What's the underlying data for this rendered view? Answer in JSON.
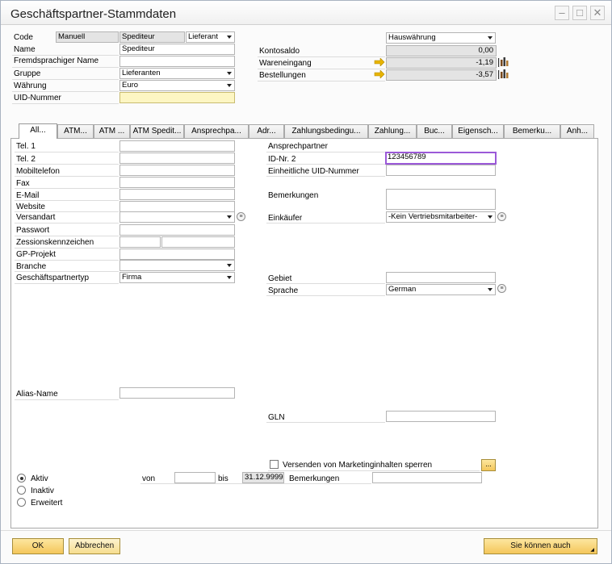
{
  "window": {
    "title": "Geschäftspartner-Stammdaten",
    "controls": [
      "–",
      "□",
      "✕"
    ]
  },
  "header": {
    "code_label": "Code",
    "code_series": "Manuell",
    "code_value": "Spediteur",
    "type_value": "Lieferant",
    "name_label": "Name",
    "name_value": "Spediteur",
    "foreign_name_label": "Fremdsprachiger Name",
    "foreign_name_value": "",
    "group_label": "Gruppe",
    "group_value": "Lieferanten",
    "currency_label": "Währung",
    "currency_value": "Euro",
    "uid_label": "UID-Nummer",
    "uid_value": "",
    "currency_select": "Hauswährung",
    "balance_label": "Kontosaldo",
    "balance_value": "0,00",
    "goods_receipt_label": "Wareneingang",
    "goods_receipt_value": "-1,19",
    "orders_label": "Bestellungen",
    "orders_value": "-3,57"
  },
  "tabs": [
    "All...",
    "ATM...",
    "ATM ...",
    "ATM Spedit...",
    "Ansprechpa...",
    "Adr...",
    "Zahlungsbedingu...",
    "Zahlung...",
    "Buc...",
    "Eigensch...",
    "Bemerku...",
    "Anh..."
  ],
  "general": {
    "tel1_label": "Tel. 1",
    "tel1_value": "",
    "tel2_label": "Tel. 2",
    "tel2_value": "",
    "mobile_label": "Mobiltelefon",
    "mobile_value": "",
    "fax_label": "Fax",
    "fax_value": "",
    "email_label": "E-Mail",
    "email_value": "",
    "website_label": "Website",
    "website_value": "",
    "shipping_label": "Versandart",
    "shipping_value": "",
    "password_label": "Passwort",
    "password_value": "",
    "factoring_label": "Zessionskennzeichen",
    "project_label": "GP-Projekt",
    "project_value": "",
    "industry_label": "Branche",
    "industry_value": "",
    "bp_type_label": "Geschäftspartnertyp",
    "bp_type_value": "Firma",
    "alias_label": "Alias-Name",
    "alias_value": "",
    "contact_label": "Ansprechpartner",
    "id2_label": "ID-Nr. 2",
    "id2_value": "123456789",
    "unified_uid_label": "Einheitliche UID-Nummer",
    "unified_uid_value": "",
    "remarks_label": "Bemerkungen",
    "remarks_value": "",
    "buyer_label": "Einkäufer",
    "buyer_value": "-Kein Vertriebsmitarbeiter-",
    "territory_label": "Gebiet",
    "territory_value": "",
    "language_label": "Sprache",
    "language_value": "German",
    "gln_label": "GLN",
    "gln_value": "",
    "marketing_block_label": "Versenden von Marketinginhalten sperren",
    "dots_label": "...",
    "active_label": "Aktiv",
    "inactive_label": "Inaktiv",
    "advanced_label": "Erweitert",
    "from_label": "von",
    "from_value": "",
    "to_label": "bis",
    "to_value": "31.12.9999",
    "status_remarks_label": "Bemerkungen",
    "status_remarks_value": ""
  },
  "footer": {
    "ok_label": "OK",
    "cancel_label": "Abbrechen",
    "more_label": "Sie können auch"
  },
  "colors": {
    "accent_button": "#f4c65a",
    "focus_border": "#9b59d8",
    "uid_field": "#fdf6c3",
    "arrow_icon": "#e8b400"
  }
}
